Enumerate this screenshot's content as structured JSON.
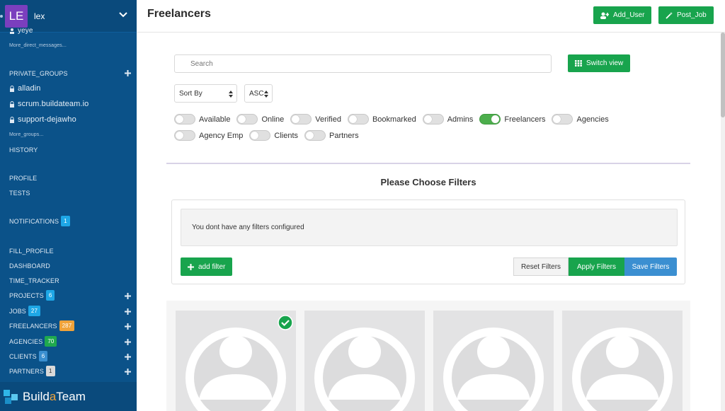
{
  "sidebar": {
    "avatar_initials": "LE",
    "username": "lex",
    "dm_partial": "yeye",
    "more_dms": "More_direct_messages...",
    "private_groups": "PRIVATE_GROUPS",
    "groups": [
      "alladin",
      "scrum.buildateam.io",
      "support-dejawho"
    ],
    "more_groups": "More_groups...",
    "history": "HISTORY",
    "profile": "PROFILE",
    "tests": "TESTS",
    "notifications": "NOTIFICATIONS",
    "notifications_count": "1",
    "fill_profile": "FILL_PROFILE",
    "dashboard": "DASHBOARD",
    "time_tracker": "TIME_TRACKER",
    "projects": "PROJECTS",
    "projects_count": "6",
    "jobs": "JOBS",
    "jobs_count": "27",
    "freelancers": "FREELANCERS",
    "freelancers_count": "287",
    "agencies": "AGENCIES",
    "agencies_count": "70",
    "clients": "CLIENTS",
    "clients_count": "6",
    "partners": "PARTNERS",
    "partners_count": "1",
    "logo_pre": "Build",
    "logo_a": "a",
    "logo_post": "Team"
  },
  "header": {
    "title": "Freelancers",
    "add_user": "Add_User",
    "post_job": "Post_Job"
  },
  "main": {
    "search_placeholder": "Search",
    "switch_view": "Switch view",
    "sort_by": "Sort By",
    "order": "ASC",
    "toggles_row1": [
      {
        "label": "Available",
        "on": false
      },
      {
        "label": "Online",
        "on": false
      },
      {
        "label": "Verified",
        "on": false
      },
      {
        "label": "Bookmarked",
        "on": false
      },
      {
        "label": "Admins",
        "on": false
      },
      {
        "label": "Freelancers",
        "on": true
      },
      {
        "label": "Agencies",
        "on": false
      }
    ],
    "toggles_row2": [
      {
        "label": "Agency Emp",
        "on": false
      },
      {
        "label": "Clients",
        "on": false
      },
      {
        "label": "Partners",
        "on": false
      }
    ],
    "filters_title": "Please Choose Filters",
    "filters_message": "You dont have any filters configured",
    "add_filter": "add filter",
    "reset_filters": "Reset Filters",
    "apply_filters": "Apply Filters",
    "save_filters": "Save Filters"
  },
  "colors": {
    "sidebar_bg": "#0b5289",
    "accent_green": "#18a44d",
    "save_blue": "#3b8fd1"
  }
}
